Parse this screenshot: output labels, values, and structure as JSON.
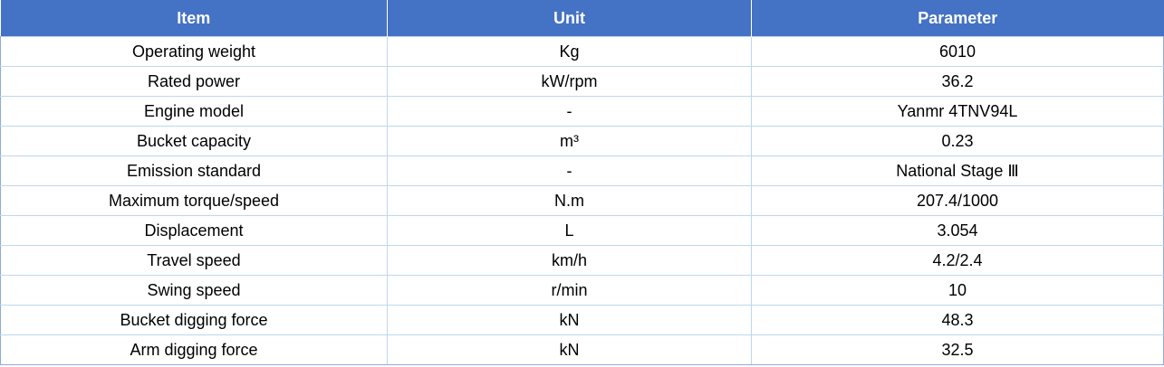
{
  "table": {
    "headers": [
      "Item",
      "Unit",
      "Parameter"
    ],
    "rows": [
      [
        "Operating weight",
        "Kg",
        "6010"
      ],
      [
        "Rated power",
        "kW/rpm",
        "36.2"
      ],
      [
        "Engine model",
        "-",
        "Yanmr 4TNV94L"
      ],
      [
        "Bucket capacity",
        "m³",
        "0.23"
      ],
      [
        "Emission standard",
        "-",
        "National Stage Ⅲ"
      ],
      [
        "Maximum torque/speed",
        "N.m",
        "207.4/1000"
      ],
      [
        "Displacement",
        "L",
        "3.054"
      ],
      [
        "Travel speed",
        "km/h",
        "4.2/2.4"
      ],
      [
        "Swing speed",
        "r/min",
        "10"
      ],
      [
        "Bucket digging force",
        "kN",
        "48.3"
      ],
      [
        "Arm digging force",
        "kN",
        "32.5"
      ]
    ]
  },
  "colors": {
    "header_bg": "#4472c4",
    "header_text": "#ffffff",
    "grid_line": "#bdd7ee"
  }
}
